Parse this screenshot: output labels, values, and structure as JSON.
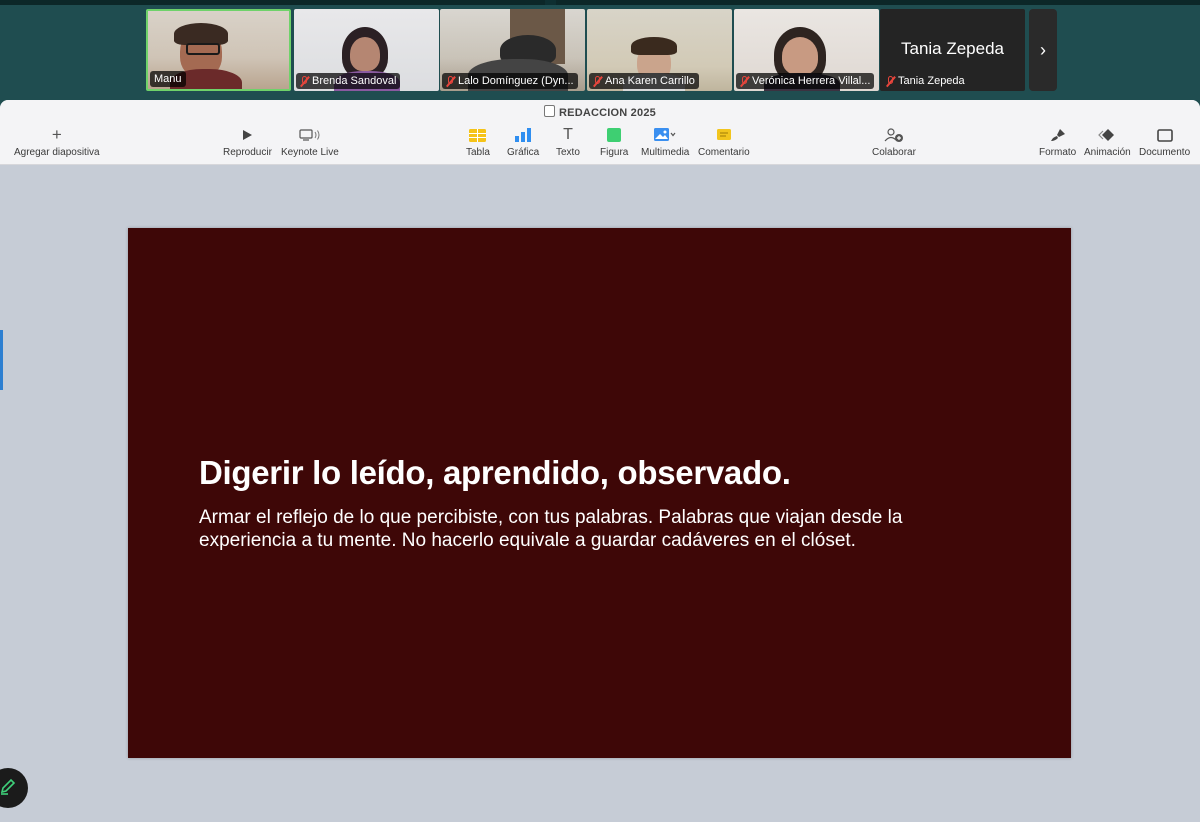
{
  "participants": [
    {
      "name": "Manu",
      "muted": false,
      "active": true
    },
    {
      "name": "Brenda Sandoval",
      "muted": true,
      "active": false
    },
    {
      "name": "Lalo Domínguez (Dyn...",
      "muted": true,
      "active": false
    },
    {
      "name": "Ana Karen Carrillo",
      "muted": true,
      "active": false
    },
    {
      "name": "Verónica Herrera Villal...",
      "muted": true,
      "active": false
    },
    {
      "name": "Tania Zepeda",
      "muted": true,
      "active": false,
      "display_name": "Tania Zepeda"
    }
  ],
  "next_icon": "chevron-right-icon",
  "window": {
    "title": "REDACCION 2025"
  },
  "toolbar": {
    "add_slide": "Agregar diapositiva",
    "play": "Reproducir",
    "keynote_live": "Keynote Live",
    "table": "Tabla",
    "chart": "Gráfica",
    "text": "Texto",
    "shape": "Figura",
    "media": "Multimedia",
    "comment": "Comentario",
    "collaborate": "Colaborar",
    "format": "Formato",
    "animate": "Animación",
    "document": "Documento"
  },
  "slide": {
    "heading": "Digerir lo leído, aprendido, observado.",
    "body": "Armar el reflejo de lo que percibiste, con tus palabras. Palabras que viajan desde la experiencia a tu mente.  No hacerlo equivale a guardar cadáveres en el clóset.",
    "background": "#3e0707"
  },
  "colors": {
    "strip_bg": "#1f4d50",
    "active_border": "#6fd26a",
    "mute_red": "#e8453c"
  }
}
